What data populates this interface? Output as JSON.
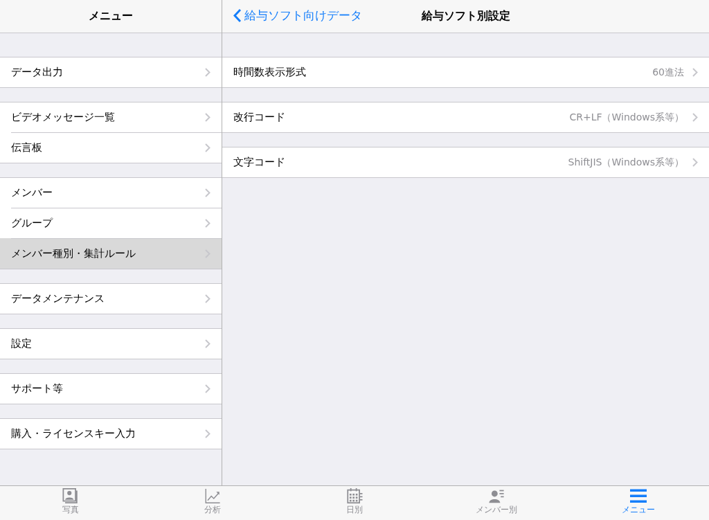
{
  "sidebar": {
    "title": "メニュー",
    "sections": [
      [
        {
          "label": "データ出力",
          "selected": false
        }
      ],
      [
        {
          "label": "ビデオメッセージ一覧",
          "selected": false
        },
        {
          "label": "伝言板",
          "selected": false
        }
      ],
      [
        {
          "label": "メンバー",
          "selected": false
        },
        {
          "label": "グループ",
          "selected": false
        },
        {
          "label": "メンバー種別・集計ルール",
          "selected": true
        }
      ],
      [
        {
          "label": "データメンテナンス",
          "selected": false
        }
      ],
      [
        {
          "label": "設定",
          "selected": false
        }
      ],
      [
        {
          "label": "サポート等",
          "selected": false
        }
      ],
      [
        {
          "label": "購入・ライセンスキー入力",
          "selected": false
        }
      ]
    ]
  },
  "detail": {
    "back": "給与ソフト向けデータ",
    "title": "給与ソフト別設定",
    "sections": [
      [
        {
          "label": "時間数表示形式",
          "value": "60進法"
        }
      ],
      [
        {
          "label": "改行コード",
          "value": "CR+LF（Windows系等）"
        }
      ],
      [
        {
          "label": "文字コード",
          "value": "ShiftJIS（Windows系等）"
        }
      ]
    ]
  },
  "tabs": [
    {
      "kind": "photo",
      "label": "写真",
      "selected": false
    },
    {
      "kind": "chart",
      "label": "分析",
      "selected": false
    },
    {
      "kind": "calendar",
      "label": "日別",
      "selected": false
    },
    {
      "kind": "person",
      "label": "メンバー別",
      "selected": false
    },
    {
      "kind": "menu",
      "label": "メニュー",
      "selected": true
    }
  ]
}
